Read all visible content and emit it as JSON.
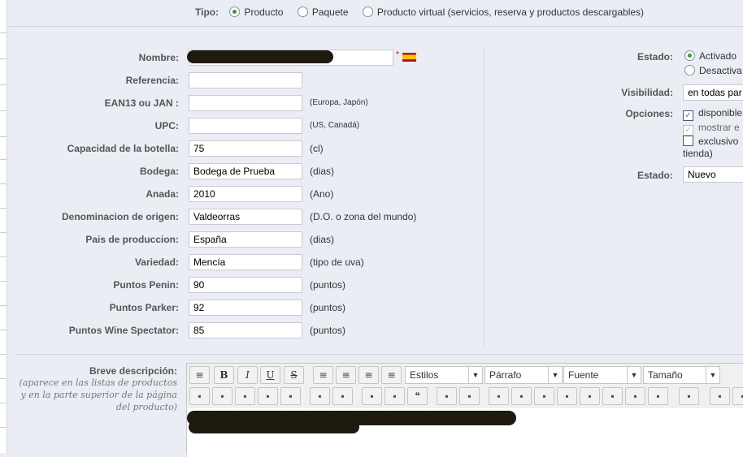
{
  "tipo": {
    "label": "Tipo:",
    "options": [
      "Producto",
      "Paquete",
      "Producto virtual (servicios, reserva y productos descargables)"
    ],
    "selected": 0
  },
  "fields": [
    {
      "label": "Nombre:",
      "value": "",
      "required": "*"
    },
    {
      "label": "Referencia:",
      "value": "",
      "hint": ""
    },
    {
      "label": "EAN13 ou JAN :",
      "value": "",
      "hint": "(Europa, Japón)"
    },
    {
      "label": "UPC:",
      "value": "",
      "hint": "(US, Canadá)"
    },
    {
      "label": "Capacidad de la botella:",
      "value": "75",
      "hint": "(cl)"
    },
    {
      "label": "Bodega:",
      "value": "Bodega de Prueba",
      "hint": "(dias)"
    },
    {
      "label": "Anada:",
      "value": "2010",
      "hint": "(Ano)"
    },
    {
      "label": "Denominacion de origen:",
      "value": "Valdeorras",
      "hint": "(D.O. o zona del mundo)"
    },
    {
      "label": "Pais de produccion:",
      "value": "España",
      "hint": "(dias)"
    },
    {
      "label": "Variedad:",
      "value": "Mencía",
      "hint": "(tipo de uva)"
    },
    {
      "label": "Puntos Penin:",
      "value": "90",
      "hint": "(puntos)"
    },
    {
      "label": "Puntos Parker:",
      "value": "92",
      "hint": "(puntos)"
    },
    {
      "label": "Puntos Wine Spectator:",
      "value": "85",
      "hint": "(puntos)"
    }
  ],
  "right": {
    "estado_label": "Estado:",
    "estado_options": [
      "Activado",
      "Desactiva"
    ],
    "visibilidad_label": "Visibilidad:",
    "visibilidad_value": "en todas par",
    "opciones_label": "Opciones:",
    "opciones": [
      {
        "label": "disponible",
        "checked": true
      },
      {
        "label": "mostrar e",
        "checked": true,
        "disabled": true
      },
      {
        "label": "exclusivo",
        "checked": false
      }
    ],
    "opciones_wrap": "tienda)",
    "condicion_label": "Estado:",
    "condicion_value": "Nuevo"
  },
  "description": {
    "label": "Breve descripción:",
    "note": "(aparece en las listas de productos y en la parte superior de la página del producto)"
  },
  "editor": {
    "dropdowns": [
      "Estilos",
      "Párrafo",
      "Fuente",
      "Tamaño"
    ],
    "buttons_row1": [
      "new-document",
      "bold",
      "italic",
      "underline",
      "strikethrough",
      "align-left",
      "align-center",
      "align-right",
      "justify"
    ],
    "bold": "B",
    "italic": "I",
    "underline": "U",
    "strike": "S",
    "quote": "“"
  },
  "colors": {
    "background": "#ebedf4",
    "radio_on": "#3a9a3a"
  }
}
